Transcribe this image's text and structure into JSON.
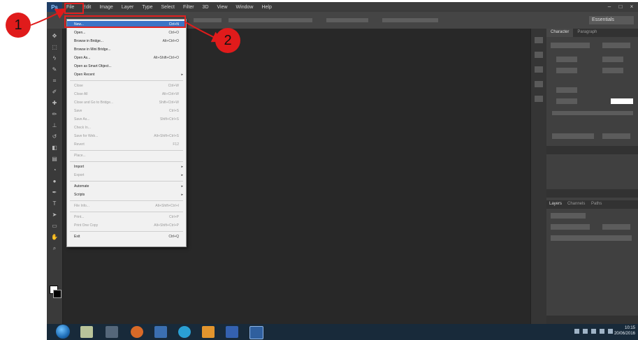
{
  "app": {
    "logo": "Ps"
  },
  "menubar": {
    "items": [
      "File",
      "Edit",
      "Image",
      "Layer",
      "Type",
      "Select",
      "Filter",
      "3D",
      "View",
      "Window",
      "Help"
    ],
    "window_buttons": [
      "–",
      "□",
      "×"
    ]
  },
  "options_bar": {
    "workspace": "Essentials"
  },
  "file_menu": {
    "items": [
      {
        "label": "New...",
        "shortcut": "Ctrl+N",
        "state": "selected"
      },
      {
        "label": "Open...",
        "shortcut": "Ctrl+O"
      },
      {
        "label": "Browse in Bridge...",
        "shortcut": "Alt+Ctrl+O"
      },
      {
        "label": "Browse in Mini Bridge..."
      },
      {
        "label": "Open As...",
        "shortcut": "Alt+Shift+Ctrl+O"
      },
      {
        "label": "Open as Smart Object..."
      },
      {
        "label": "Open Recent",
        "submenu": true
      },
      {
        "label": "Close",
        "shortcut": "Ctrl+W",
        "state": "disabled"
      },
      {
        "label": "Close All",
        "shortcut": "Alt+Ctrl+W",
        "state": "disabled"
      },
      {
        "label": "Close and Go to Bridge...",
        "shortcut": "Shift+Ctrl+W",
        "state": "disabled"
      },
      {
        "label": "Save",
        "shortcut": "Ctrl+S",
        "state": "disabled"
      },
      {
        "label": "Save As...",
        "shortcut": "Shift+Ctrl+S",
        "state": "disabled"
      },
      {
        "label": "Check In...",
        "state": "disabled"
      },
      {
        "label": "Save for Web...",
        "shortcut": "Alt+Shift+Ctrl+S",
        "state": "disabled"
      },
      {
        "label": "Revert",
        "shortcut": "F12",
        "state": "disabled"
      },
      {
        "label": "Place...",
        "state": "disabled"
      },
      {
        "label": "Import",
        "submenu": true
      },
      {
        "label": "Export",
        "submenu": true,
        "state": "disabled"
      },
      {
        "label": "Automate",
        "submenu": true
      },
      {
        "label": "Scripts",
        "submenu": true
      },
      {
        "label": "File Info...",
        "shortcut": "Alt+Shift+Ctrl+I",
        "state": "disabled"
      },
      {
        "label": "Print...",
        "shortcut": "Ctrl+P",
        "state": "disabled"
      },
      {
        "label": "Print One Copy",
        "shortcut": "Alt+Shift+Ctrl+P",
        "state": "disabled"
      },
      {
        "label": "Exit",
        "shortcut": "Ctrl+Q"
      }
    ],
    "separators_after": [
      6,
      14,
      15,
      17,
      19,
      20,
      22
    ]
  },
  "panels": {
    "top_tabs": [
      "Character",
      "Paragraph"
    ],
    "layers_tabs": [
      "Layers",
      "Channels",
      "Paths"
    ]
  },
  "taskbar": {
    "clock_time": "10:15",
    "clock_date": "20/06/2016"
  },
  "annotations": [
    {
      "label": "1",
      "target": "File menu"
    },
    {
      "label": "2",
      "target": "New... menu item"
    }
  ],
  "colors": {
    "annotation": "#e01b1b",
    "selection": "#3b74c6"
  }
}
